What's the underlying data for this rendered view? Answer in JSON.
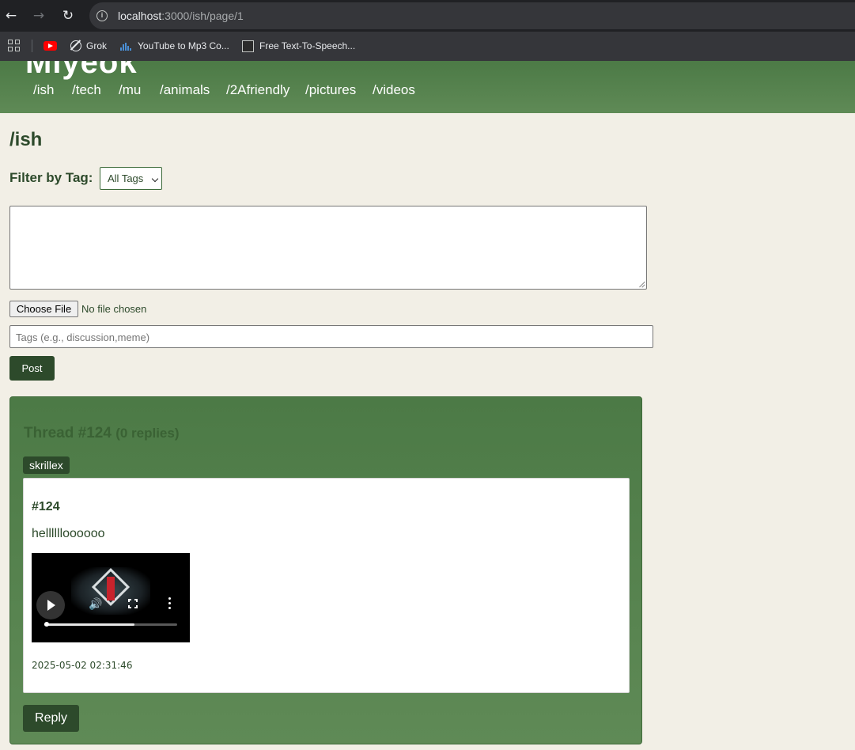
{
  "browser": {
    "url_host": "localhost",
    "url_path": ":3000/ish/page/1",
    "back_icon": "arrow-left-icon",
    "forward_icon": "arrow-right-icon",
    "reload_icon": "reload-icon",
    "bookmarks": [
      {
        "label": "",
        "icon": "youtube-icon"
      },
      {
        "label": "Grok",
        "icon": "grok-icon"
      },
      {
        "label": "YouTube to Mp3 Co...",
        "icon": "audio-bars-icon"
      },
      {
        "label": "Free Text-To-Speech...",
        "icon": "tts-icon"
      }
    ]
  },
  "site": {
    "logo": "Miyeok",
    "nav": [
      "/ish",
      "/tech",
      "/mu",
      "/animals",
      "/2Afriendly",
      "/pictures",
      "/videos"
    ],
    "colors": {
      "header": "#5f8a56",
      "dark_green": "#2d4a2b",
      "background": "#f2efe6"
    }
  },
  "board": {
    "title": "/ish",
    "filter_label": "Filter by Tag:",
    "filter_selected": "All Tags"
  },
  "form": {
    "textarea_value": "",
    "choose_file_label": "Choose File",
    "no_file_text": "No file chosen",
    "tags_placeholder": "Tags (e.g., discussion,meme)",
    "post_label": "Post"
  },
  "thread": {
    "title": "Thread #124",
    "replies": "(0 replies)",
    "tag": "skrillex",
    "post": {
      "id": "#124",
      "body": "helllllloooooo",
      "video_progress": 0.68,
      "timestamp": "2025-05-02 02:31:46"
    },
    "reply_label": "Reply"
  }
}
